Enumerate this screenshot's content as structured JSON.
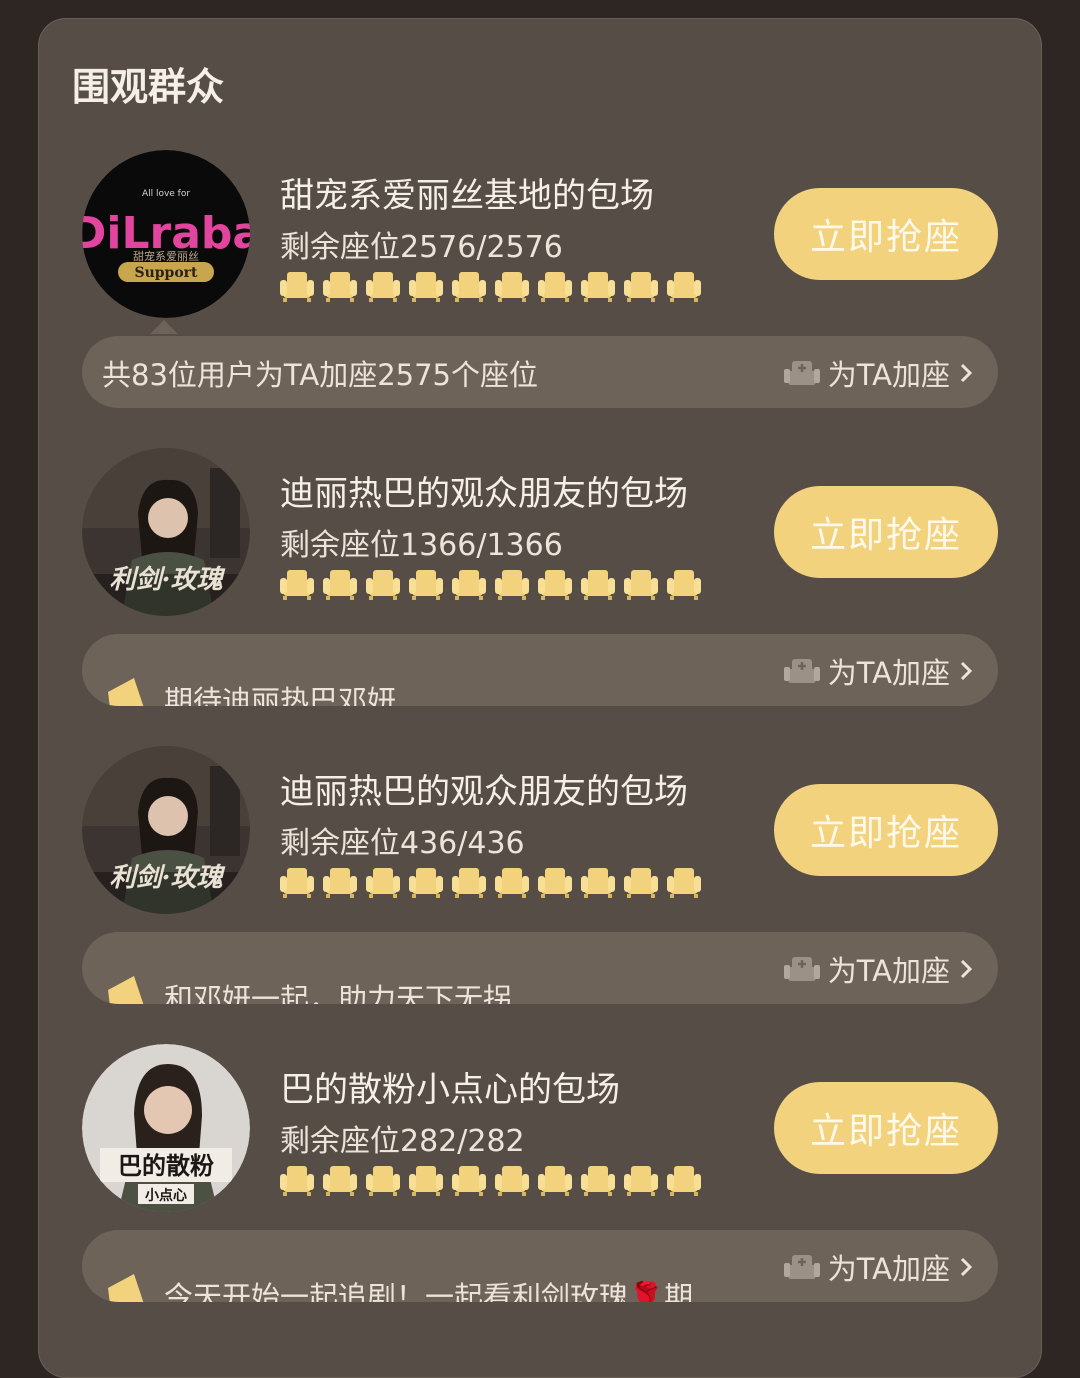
{
  "header": {
    "title": "围观群众"
  },
  "labels": {
    "grab_button": "立即抢座",
    "add_seat": "为TA加座"
  },
  "colors": {
    "accent": "#f2d27c",
    "panel": "#564d47",
    "bar": "#6d6359",
    "background": "#2d2622"
  },
  "cards": [
    {
      "name": "甜宠系爱丽丝基地的包场",
      "seats_remaining": "剩余座位2576/2576",
      "avatar_small": "All love for",
      "avatar_logo": "DiLraba",
      "avatar_sub": "甜宠系爱丽丝",
      "avatar_badge": "Support",
      "bar_text": "共83位用户为TA加座2575个座位"
    },
    {
      "name": "迪丽热巴的观众朋友的包场",
      "seats_remaining": "剩余座位1366/1366",
      "avatar_caption": "利剑·玫瑰",
      "bar_text": "期待迪丽热巴邓妍"
    },
    {
      "name": "迪丽热巴的观众朋友的包场",
      "seats_remaining": "剩余座位436/436",
      "avatar_caption": "利剑·玫瑰",
      "bar_text": "和邓妍一起，助力天下无拐"
    },
    {
      "name": "巴的散粉小点心的包场",
      "seats_remaining": "剩余座位282/282",
      "avatar_caption": "巴的散粉",
      "avatar_caption2": "小点心",
      "bar_text": "今天开始一起追剧！一起看利剑玫瑰🌹期..."
    }
  ]
}
